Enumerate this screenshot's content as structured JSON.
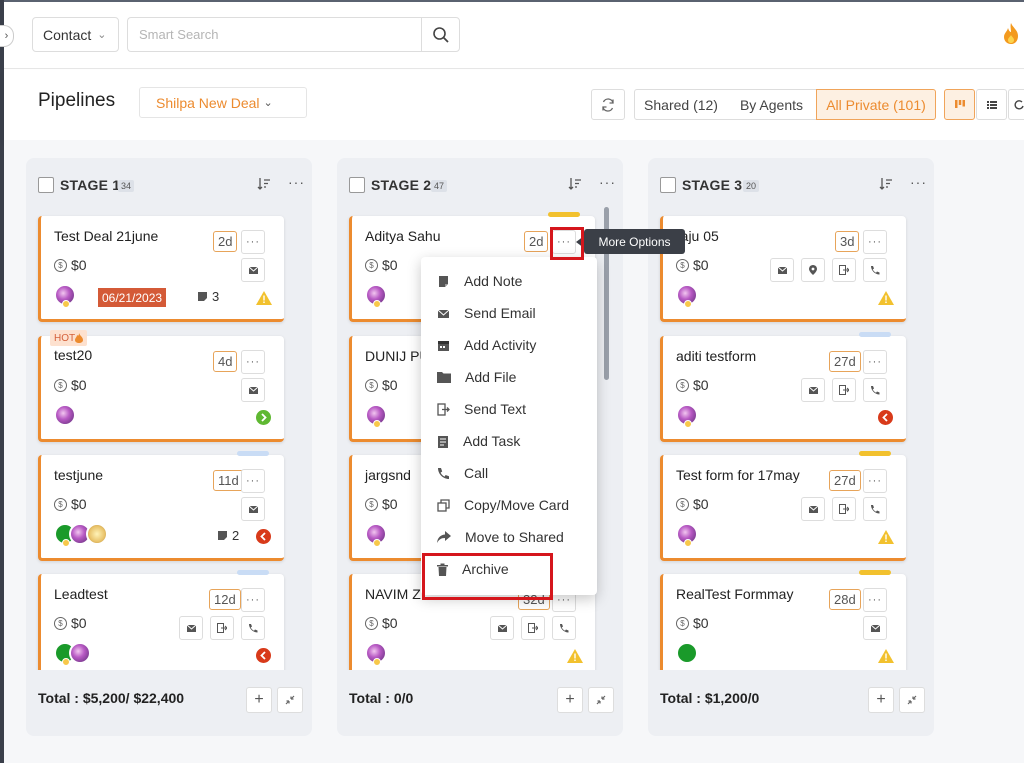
{
  "topbar": {
    "contact_select": "Contact",
    "search_placeholder": "Smart Search"
  },
  "header": {
    "title": "Pipelines",
    "pipeline_select": "Shilpa New Deal",
    "filters": [
      {
        "label": "Shared (12)",
        "active": false
      },
      {
        "label": "By Agents",
        "active": false
      },
      {
        "label": "All Private (101)",
        "active": true
      }
    ]
  },
  "columns": [
    {
      "title": "STAGE 1",
      "count": "34",
      "total": "Total : $5,200/ $22,400",
      "cards": [
        {
          "title": "Test Deal 21june",
          "amount": "$0",
          "age": "2d",
          "date": "06/21/2023",
          "notes": "3",
          "status": "warning"
        },
        {
          "title": "test20",
          "amount": "$0",
          "age": "4d",
          "tag": "HOT",
          "status": "next"
        },
        {
          "title": "testjune",
          "amount": "$0",
          "age": "11d",
          "notes": "2",
          "status": "back"
        },
        {
          "title": "Leadtest",
          "amount": "$0",
          "age": "12d",
          "status": "back"
        }
      ]
    },
    {
      "title": "STAGE 2",
      "count": "47",
      "total": "Total : 0/0",
      "cards": [
        {
          "title": "Aditya Sahu",
          "amount": "$0",
          "age": "2d"
        },
        {
          "title": "DUNIJ PU",
          "amount": "$0"
        },
        {
          "title": "jargsnd",
          "amount": "$0"
        },
        {
          "title": "NAVIM Z",
          "amount": "$0",
          "age": "32d",
          "status": "warning"
        }
      ]
    },
    {
      "title": "STAGE 3",
      "count": "20",
      "total": "Total : $1,200/0",
      "cards": [
        {
          "title": "raju 05",
          "amount": "$0",
          "age": "3d",
          "status": "warning"
        },
        {
          "title": "aditi testform",
          "amount": "$0",
          "age": "27d",
          "status": "back"
        },
        {
          "title": "Test form for 17may",
          "amount": "$0",
          "age": "27d",
          "status": "warning"
        },
        {
          "title": "RealTest Formmay",
          "amount": "$0",
          "age": "28d",
          "status": "warning"
        }
      ]
    }
  ],
  "tooltip": "More Options",
  "menu": [
    {
      "label": "Add Note",
      "icon": "note-icon"
    },
    {
      "label": "Send Email",
      "icon": "email-icon"
    },
    {
      "label": "Add Activity",
      "icon": "activity-icon"
    },
    {
      "label": "Add File",
      "icon": "folder-icon"
    },
    {
      "label": "Send Text",
      "icon": "text-icon"
    },
    {
      "label": "Add Task",
      "icon": "task-icon"
    },
    {
      "label": "Call",
      "icon": "phone-icon"
    },
    {
      "label": "Copy/Move Card",
      "icon": "copy-icon"
    },
    {
      "label": "Move to Shared",
      "icon": "share-icon"
    },
    {
      "label": "Archive",
      "icon": "trash-icon"
    }
  ],
  "colors": {
    "accent": "#ec8b2f",
    "highlight": "#d5161c",
    "warning": "#f2c12e",
    "success": "#5fb832",
    "danger": "#d83a1a"
  }
}
